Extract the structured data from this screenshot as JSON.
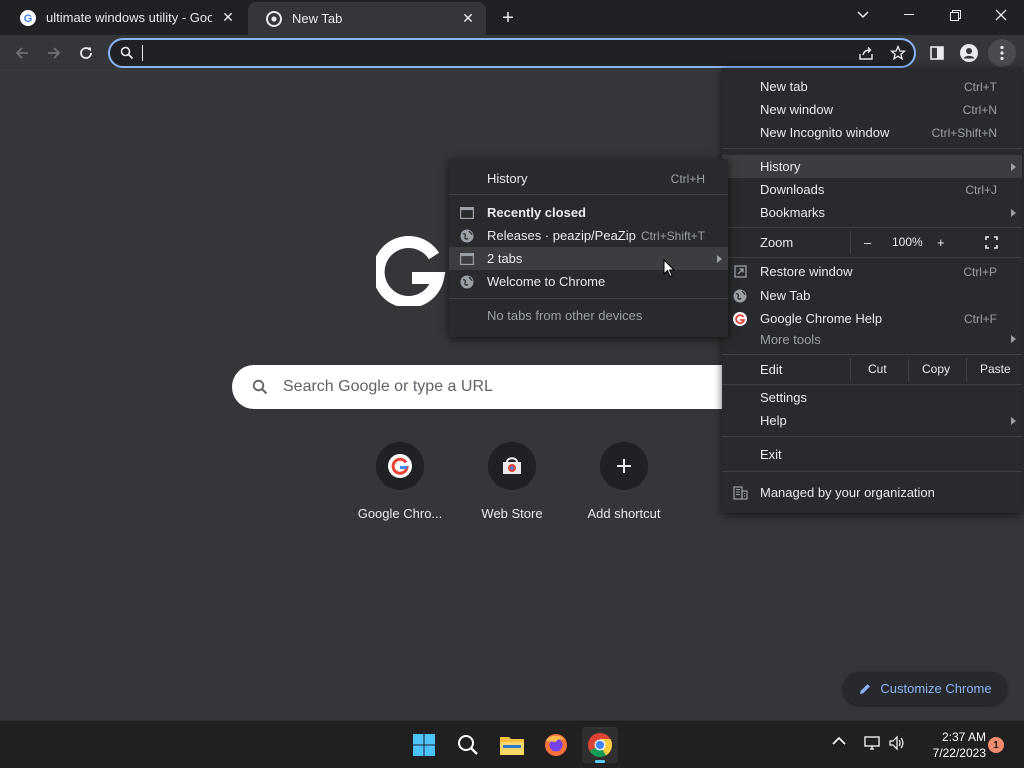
{
  "tabs": [
    {
      "title": "ultimate windows utility - Google",
      "favicon": "google-g-icon"
    },
    {
      "title": "New Tab",
      "favicon": "chrome-icon"
    }
  ],
  "omnibox": {
    "value": ""
  },
  "ntp": {
    "search_placeholder": "Search Google or type a URL",
    "shortcuts": [
      {
        "label": "Google Chro...",
        "icon": "google-g-icon"
      },
      {
        "label": "Web Store",
        "icon": "web-store-icon"
      },
      {
        "label": "Add shortcut",
        "icon": "plus-icon"
      }
    ],
    "customize_label": "Customize Chrome"
  },
  "main_menu": {
    "new_tab": {
      "label": "New tab",
      "shortcut": "Ctrl+T"
    },
    "new_window": {
      "label": "New window",
      "shortcut": "Ctrl+N"
    },
    "new_incognito": {
      "label": "New Incognito window",
      "shortcut": "Ctrl+Shift+N"
    },
    "history": {
      "label": "History"
    },
    "downloads": {
      "label": "Downloads",
      "shortcut": "Ctrl+J"
    },
    "bookmarks": {
      "label": "Bookmarks"
    },
    "zoom": {
      "label": "Zoom",
      "minus": "–",
      "value": "100%",
      "plus": "+"
    },
    "restore_window": {
      "label": "Restore window",
      "shortcut": "Ctrl+P"
    },
    "new_tab_recent": {
      "label": "New Tab"
    },
    "chrome_help": {
      "label": "Google Chrome Help",
      "shortcut": "Ctrl+F"
    },
    "more_tools": {
      "label": "More tools"
    },
    "edit": {
      "label": "Edit",
      "cut": "Cut",
      "copy": "Copy",
      "paste": "Paste"
    },
    "settings": {
      "label": "Settings"
    },
    "help": {
      "label": "Help"
    },
    "exit": {
      "label": "Exit"
    },
    "managed": {
      "label": "Managed by your organization"
    }
  },
  "history_menu": {
    "history": {
      "label": "History",
      "shortcut": "Ctrl+H"
    },
    "recently_closed": {
      "label": "Recently closed"
    },
    "releases": {
      "label": "Releases · peazip/PeaZip",
      "shortcut": "Ctrl+Shift+T"
    },
    "two_tabs": {
      "label": "2 tabs"
    },
    "welcome": {
      "label": "Welcome to Chrome"
    },
    "no_tabs": {
      "label": "No tabs from other devices"
    }
  },
  "taskbar": {
    "time": "2:37 AM",
    "date": "7/22/2023",
    "notification_count": "1",
    "apps": [
      "windows-start-icon",
      "search-icon",
      "file-explorer-icon",
      "firefox-icon",
      "chrome-icon"
    ]
  },
  "colors": {
    "accent": "#8ab4f8",
    "menu_bg": "#292a2d",
    "page_bg": "#35363a",
    "frame_bg": "#202124"
  }
}
